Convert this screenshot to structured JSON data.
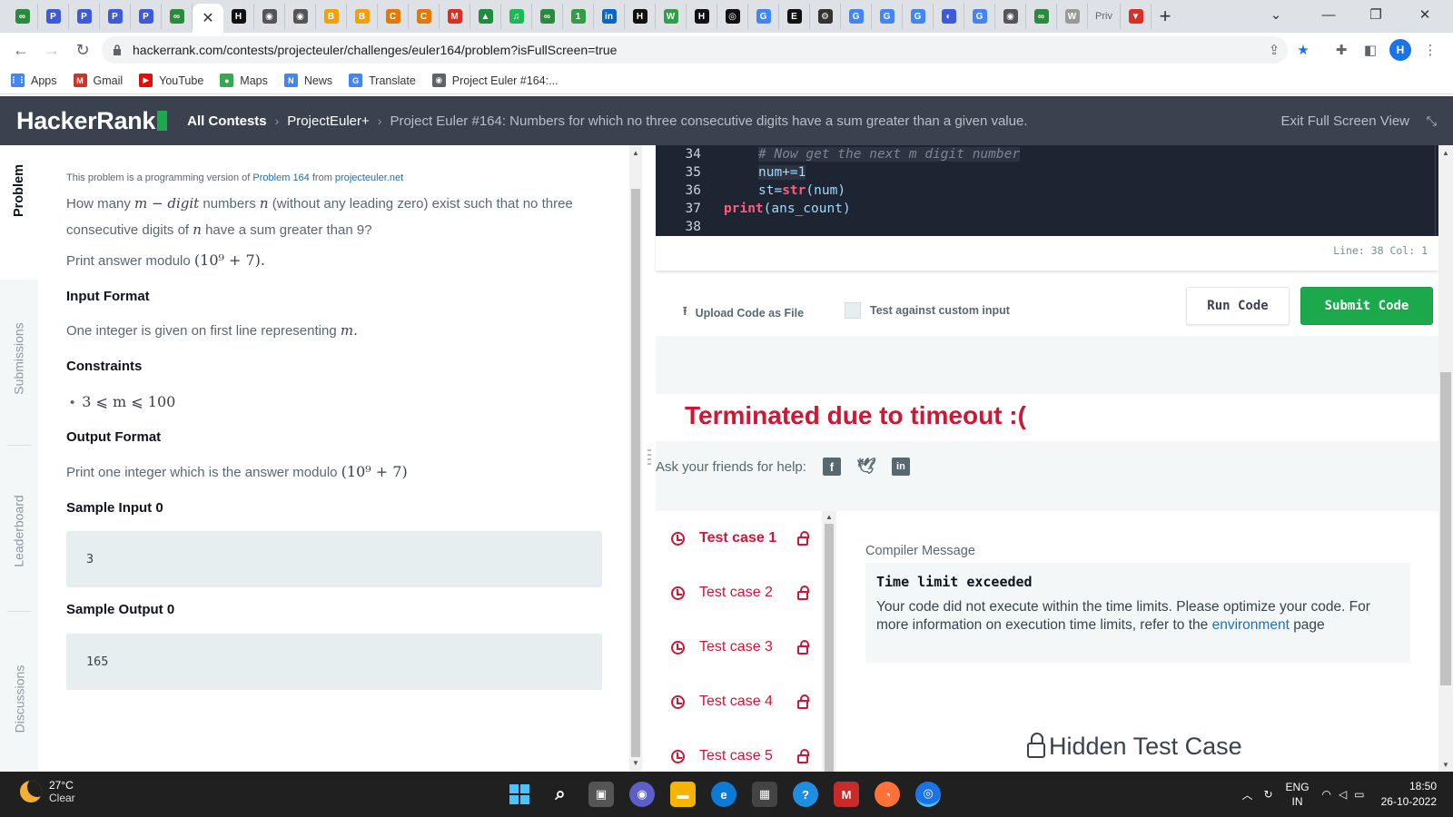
{
  "browser": {
    "tabs": [
      {
        "icon": "infinity-icon",
        "glyph": "∞",
        "color": "#2b8a3e"
      },
      {
        "icon": "p-icon",
        "glyph": "P",
        "color": "#3b5bdb"
      },
      {
        "icon": "p-icon",
        "glyph": "P",
        "color": "#3b5bdb"
      },
      {
        "icon": "p-icon",
        "glyph": "P",
        "color": "#3b5bdb"
      },
      {
        "icon": "p-icon",
        "glyph": "P",
        "color": "#3b5bdb"
      },
      {
        "icon": "infinity-icon",
        "glyph": "∞",
        "color": "#2b8a3e"
      },
      {
        "icon": "close-icon",
        "glyph": "✕",
        "color": "#333333",
        "active": true
      },
      {
        "icon": "hackerrank-icon",
        "glyph": "H",
        "color": "#111111"
      },
      {
        "icon": "globe-icon",
        "glyph": "◉",
        "color": "#555555"
      },
      {
        "icon": "globe-icon",
        "glyph": "◉",
        "color": "#555555"
      },
      {
        "icon": "blogger-icon",
        "glyph": "B",
        "color": "#f59f00"
      },
      {
        "icon": "blogger-icon",
        "glyph": "B",
        "color": "#f59f00"
      },
      {
        "icon": "c-icon",
        "glyph": "C",
        "color": "#e67700"
      },
      {
        "icon": "c-icon",
        "glyph": "C",
        "color": "#e67700"
      },
      {
        "icon": "gmail-icon",
        "glyph": "M",
        "color": "#d93025"
      },
      {
        "icon": "drive-icon",
        "glyph": "▲",
        "color": "#1e8e3e"
      },
      {
        "icon": "spotify-icon",
        "glyph": "♫",
        "color": "#1db954"
      },
      {
        "icon": "infinity-icon",
        "glyph": "∞",
        "color": "#2b8a3e"
      },
      {
        "icon": "one-icon",
        "glyph": "1",
        "color": "#2f9e44"
      },
      {
        "icon": "linkedin-icon",
        "glyph": "in",
        "color": "#0a66c2"
      },
      {
        "icon": "hackerrank-icon",
        "glyph": "H",
        "color": "#111111"
      },
      {
        "icon": "w-icon",
        "glyph": "W",
        "color": "#2f9e44"
      },
      {
        "icon": "hackerrank-icon",
        "glyph": "H",
        "color": "#111111"
      },
      {
        "icon": "circle-icon",
        "glyph": "◎",
        "color": "#111111"
      },
      {
        "icon": "google-icon",
        "glyph": "G",
        "color": "#4285f4"
      },
      {
        "icon": "e-icon",
        "glyph": "E",
        "color": "#111111"
      },
      {
        "icon": "gear-icon",
        "glyph": "⚙",
        "color": "#333333"
      },
      {
        "icon": "google-icon",
        "glyph": "G",
        "color": "#4285f4"
      },
      {
        "icon": "google-icon",
        "glyph": "G",
        "color": "#4285f4"
      },
      {
        "icon": "google-icon",
        "glyph": "G",
        "color": "#4285f4"
      },
      {
        "icon": "shield-icon",
        "glyph": "◐",
        "color": "#3b5bdb"
      },
      {
        "icon": "google-icon",
        "glyph": "G",
        "color": "#4285f4"
      },
      {
        "icon": "globe-icon",
        "glyph": "◉",
        "color": "#555555"
      },
      {
        "icon": "infinity-icon",
        "glyph": "∞",
        "color": "#2b8a3e"
      },
      {
        "icon": "w-icon",
        "glyph": "W",
        "color": "#999999"
      }
    ],
    "priv_tab": "Priv",
    "url": "hackerrank.com/contests/projecteuler/challenges/euler164/problem?isFullScreen=true",
    "profile_initial": "H",
    "bookmarks": [
      {
        "label": "Apps",
        "icon": "apps-grid-icon",
        "color": "#4285f4",
        "glyph": "⋮⋮"
      },
      {
        "label": "Gmail",
        "icon": "gmail-icon",
        "color": "#d93025",
        "glyph": "M"
      },
      {
        "label": "YouTube",
        "icon": "youtube-icon",
        "color": "#ff0000",
        "glyph": "▶"
      },
      {
        "label": "Maps",
        "icon": "maps-pin-icon",
        "color": "#34a853",
        "glyph": "●"
      },
      {
        "label": "News",
        "icon": "news-icon",
        "color": "#4285f4",
        "glyph": "N"
      },
      {
        "label": "Translate",
        "icon": "translate-icon",
        "color": "#4285f4",
        "glyph": "G"
      },
      {
        "label": "Project Euler #164:...",
        "icon": "globe-icon",
        "color": "#5f6368",
        "glyph": "◉"
      }
    ]
  },
  "header": {
    "logo": "HackerRank",
    "crumbs": [
      "All Contests",
      "ProjectEuler+"
    ],
    "title": "Project Euler #164: Numbers for which no three consecutive digits have a sum greater than a given value.",
    "exit_label": "Exit Full Screen View"
  },
  "vnav": [
    "Problem",
    "Submissions",
    "Leaderboard",
    "Discussions"
  ],
  "problem": {
    "note_prefix": "This problem is a programming version of",
    "note_link1": "Problem 164",
    "note_mid": "from",
    "note_link2": "projecteuler.net",
    "q1": "How many",
    "q_math1": "m − digit",
    "q2": "numbers",
    "q_math2": "n",
    "q3": "(without any leading zero) exist such that no three",
    "q4": "consecutive digits of",
    "q_math3": "n",
    "q5": "have a sum greater than 9?",
    "print_prefix": "Print answer modulo",
    "print_math": "(10⁹ + 7).",
    "input_heading": "Input Format",
    "input_text": "One integer is given on first line representing",
    "input_math": "m.",
    "constraints_heading": "Constraints",
    "constraint": "3 ⩽ m ⩽ 100",
    "output_heading": "Output Format",
    "output_text": "Print one integer which is the answer modulo",
    "output_math": "(10⁹ + 7)",
    "sample_input_heading": "Sample Input 0",
    "sample_input": "3",
    "sample_output_heading": "Sample Output 0",
    "sample_output": "165"
  },
  "editor": {
    "lines": [
      {
        "n": "34",
        "text": "# Now get the next m digit number"
      },
      {
        "n": "35",
        "text": "num+=1"
      },
      {
        "n": "36",
        "text_a": "st=",
        "text_b": "str",
        "text_c": "(num)"
      },
      {
        "n": "37",
        "text_a": "print",
        "text_c": "(ans_count)"
      },
      {
        "n": "38",
        "text": ""
      }
    ],
    "status": "Line: 38 Col: 1",
    "upload_label": "Upload Code as File",
    "custom_label": "Test against custom input",
    "run_label": "Run Code",
    "submit_label": "Submit Code"
  },
  "result": {
    "status": "Terminated due to timeout :(",
    "ask_friends": "Ask your friends for help:",
    "testcases": [
      "Test case 1",
      "Test case 2",
      "Test case 3",
      "Test case 4",
      "Test case 5"
    ],
    "compiler_label": "Compiler Message",
    "compiler_title": "Time limit exceeded",
    "compiler_msg": "Your code did not execute within the time limits. Please optimize your code. For more information on execution time limits, refer to the",
    "compiler_link": "environment",
    "compiler_end": "page",
    "hidden": "Hidden Test Case"
  },
  "taskbar": {
    "temp": "27°C",
    "weather": "Clear",
    "lang1": "ENG",
    "lang2": "IN",
    "time": "18:50",
    "date": "26-10-2022"
  }
}
